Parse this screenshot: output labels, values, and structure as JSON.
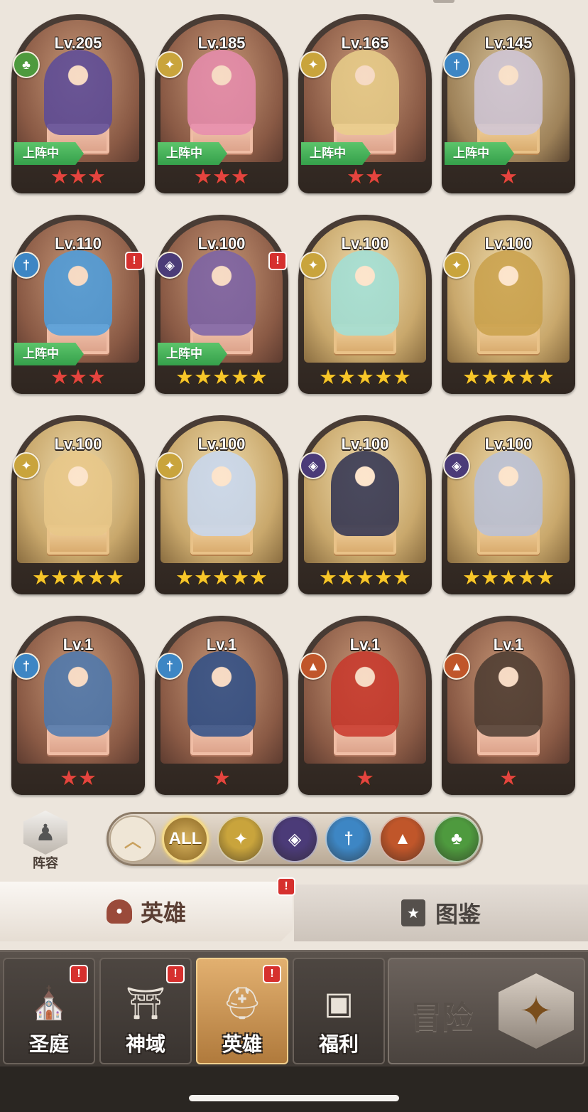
{
  "heroes": [
    {
      "level": "Lv.205",
      "faction": "nature",
      "deployed": "上阵中",
      "alert": "",
      "stars": 3,
      "star_color": "red",
      "tier": "red",
      "figure_color": "#5a4a9a"
    },
    {
      "level": "Lv.185",
      "faction": "light",
      "deployed": "上阵中",
      "alert": "",
      "stars": 3,
      "star_color": "red",
      "tier": "red",
      "figure_color": "#e78cae"
    },
    {
      "level": "Lv.165",
      "faction": "light",
      "deployed": "上阵中",
      "alert": "",
      "stars": 2,
      "star_color": "red",
      "tier": "red",
      "figure_color": "#e9cf8a"
    },
    {
      "level": "Lv.145",
      "faction": "water",
      "deployed": "上阵中",
      "alert": "",
      "stars": 1,
      "star_color": "red",
      "tier": "dark",
      "figure_color": "#cfc6d8"
    },
    {
      "level": "Lv.110",
      "faction": "water",
      "deployed": "上阵中",
      "alert": "!",
      "stars": 3,
      "star_color": "red",
      "tier": "red",
      "figure_color": "#4a9ee0"
    },
    {
      "level": "Lv.100",
      "faction": "dark",
      "deployed": "上阵中",
      "alert": "!",
      "stars": 5,
      "star_color": "gold",
      "tier": "red",
      "figure_color": "#7a62a8"
    },
    {
      "level": "Lv.100",
      "faction": "light",
      "deployed": "",
      "alert": "",
      "stars": 5,
      "star_color": "gold",
      "tier": "gold",
      "figure_color": "#9fe0d8"
    },
    {
      "level": "Lv.100",
      "faction": "light",
      "deployed": "",
      "alert": "",
      "stars": 5,
      "star_color": "gold",
      "tier": "gold",
      "figure_color": "#c9a04a"
    },
    {
      "level": "Lv.100",
      "faction": "light",
      "deployed": "",
      "alert": "",
      "stars": 5,
      "star_color": "gold",
      "tier": "gold",
      "figure_color": "#e8c788"
    },
    {
      "level": "Lv.100",
      "faction": "light",
      "deployed": "",
      "alert": "",
      "stars": 5,
      "star_color": "gold",
      "tier": "gold",
      "figure_color": "#c7d8f2"
    },
    {
      "level": "Lv.100",
      "faction": "dark",
      "deployed": "",
      "alert": "",
      "stars": 5,
      "star_color": "gold",
      "tier": "gold",
      "figure_color": "#2d3050"
    },
    {
      "level": "Lv.100",
      "faction": "dark",
      "deployed": "",
      "alert": "",
      "stars": 5,
      "star_color": "gold",
      "tier": "gold",
      "figure_color": "#b8c0d8"
    },
    {
      "level": "Lv.1",
      "faction": "water",
      "deployed": "",
      "alert": "",
      "stars": 2,
      "star_color": "red",
      "tier": "red",
      "figure_color": "#4a78b0"
    },
    {
      "level": "Lv.1",
      "faction": "water",
      "deployed": "",
      "alert": "",
      "stars": 1,
      "star_color": "red",
      "tier": "red",
      "figure_color": "#2c4e88"
    },
    {
      "level": "Lv.1",
      "faction": "beast",
      "deployed": "",
      "alert": "",
      "stars": 1,
      "star_color": "red",
      "tier": "red",
      "figure_color": "#c8362a"
    },
    {
      "level": "Lv.1",
      "faction": "beast",
      "deployed": "",
      "alert": "",
      "stars": 1,
      "star_color": "red",
      "tier": "red",
      "figure_color": "#4a3a30"
    }
  ],
  "faction_colors": {
    "nature": "#4e9a3e",
    "light": "#c9a43c",
    "water": "#3d86c4",
    "dark": "#4b3b78",
    "beast": "#c0562a"
  },
  "faction_icons": {
    "nature": "tree-icon",
    "light": "sun-icon",
    "water": "trident-icon",
    "dark": "demon-icon",
    "beast": "wolf-icon"
  },
  "team_button": {
    "label": "阵容",
    "icon": "chess-pawn-icon"
  },
  "filter_bar": {
    "collapse_icon": "chevron-up-icon",
    "all_label": "ALL",
    "factions": [
      "light",
      "dark",
      "water",
      "beast",
      "nature"
    ]
  },
  "tabs": {
    "heroes_label": "英雄",
    "heroes_alert": "!",
    "codex_label": "图鉴"
  },
  "nav": {
    "items": [
      {
        "label": "圣庭",
        "icon": "cathedral-icon",
        "alert": "!"
      },
      {
        "label": "神域",
        "icon": "shrine-icon",
        "alert": "!"
      },
      {
        "label": "英雄",
        "icon": "helmet-icon",
        "alert": "!"
      },
      {
        "label": "福利",
        "icon": "chest-icon",
        "alert": ""
      }
    ],
    "active_index": 2,
    "adventure_label": "冒险",
    "adventure_icon": "compass-icon"
  }
}
